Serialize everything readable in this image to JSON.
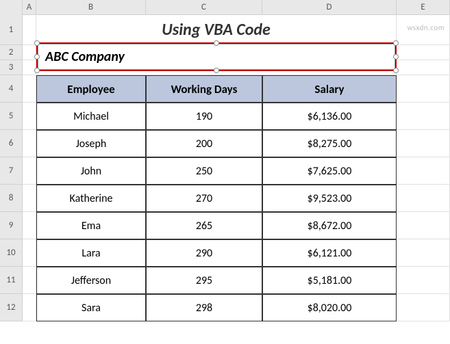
{
  "columns": [
    "A",
    "B",
    "C",
    "D",
    "E"
  ],
  "rows": [
    "1",
    "2",
    "3",
    "4",
    "5",
    "6",
    "7",
    "8",
    "9",
    "10",
    "11",
    "12"
  ],
  "title": "Using VBA Code",
  "textbox_text": "ABC Company",
  "headers": {
    "employee": "Employee",
    "working_days": "Working Days",
    "salary": "Salary"
  },
  "data": [
    {
      "employee": "Michael",
      "working_days": "190",
      "salary": "$6,136.00"
    },
    {
      "employee": "Joseph",
      "working_days": "200",
      "salary": "$8,275.00"
    },
    {
      "employee": "John",
      "working_days": "250",
      "salary": "$7,625.00"
    },
    {
      "employee": "Katherine",
      "working_days": "270",
      "salary": "$9,523.00"
    },
    {
      "employee": "Ema",
      "working_days": "265",
      "salary": "$8,672.00"
    },
    {
      "employee": "Lara",
      "working_days": "290",
      "salary": "$6,121.00"
    },
    {
      "employee": "Jefferson",
      "working_days": "295",
      "salary": "$5,181.00"
    },
    {
      "employee": "Sara",
      "working_days": "298",
      "salary": "$8,020.00"
    }
  ],
  "watermark": "wsxdn.com",
  "chart_data": {
    "type": "table",
    "title": "Using VBA Code",
    "columns": [
      "Employee",
      "Working Days",
      "Salary"
    ],
    "rows": [
      [
        "Michael",
        190,
        6136.0
      ],
      [
        "Joseph",
        200,
        8275.0
      ],
      [
        "John",
        250,
        7625.0
      ],
      [
        "Katherine",
        270,
        9523.0
      ],
      [
        "Ema",
        265,
        8672.0
      ],
      [
        "Lara",
        290,
        6121.0
      ],
      [
        "Jefferson",
        295,
        5181.0
      ],
      [
        "Sara",
        298,
        8020.0
      ]
    ]
  }
}
